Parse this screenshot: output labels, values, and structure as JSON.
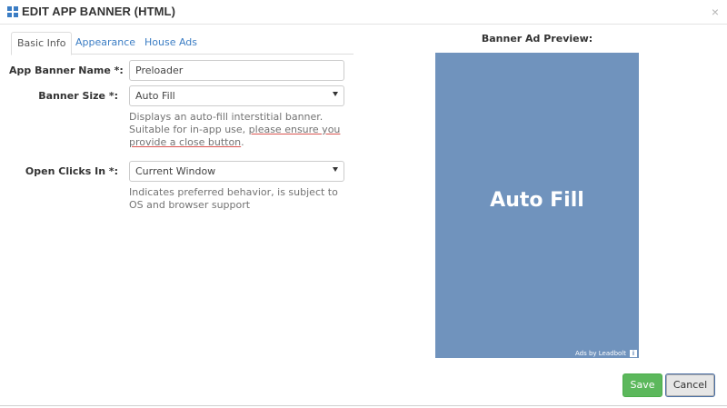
{
  "dialog": {
    "title": "EDIT APP BANNER (HTML)",
    "close_glyph": "×"
  },
  "tabs": [
    {
      "label": "Basic Info",
      "active": true
    },
    {
      "label": "Appearance",
      "active": false
    },
    {
      "label": "House Ads",
      "active": false
    }
  ],
  "form": {
    "name_label": "App Banner Name *:",
    "name_value": "Preloader",
    "size_label": "Banner Size *:",
    "size_value": "Auto Fill",
    "size_help_before": "Displays an auto-fill interstitial banner. Suitable for in-app use, ",
    "size_help_warning": "please ensure you provide a close button",
    "size_help_after": ".",
    "clicks_label": "Open Clicks In *:",
    "clicks_value": "Current Window",
    "clicks_help": "Indicates preferred behavior, is subject to OS and browser support"
  },
  "preview": {
    "title": "Banner Ad Preview:",
    "ad_text": "Auto Fill",
    "ads_by": "Ads by Leadbolt",
    "info_glyph": "i",
    "background_color": "#7093bd"
  },
  "footer": {
    "save_label": "Save",
    "cancel_label": "Cancel"
  },
  "colors": {
    "accent": "#3b7dc4",
    "save_green": "#5cb85c",
    "warning_underline": "#d9534f"
  }
}
